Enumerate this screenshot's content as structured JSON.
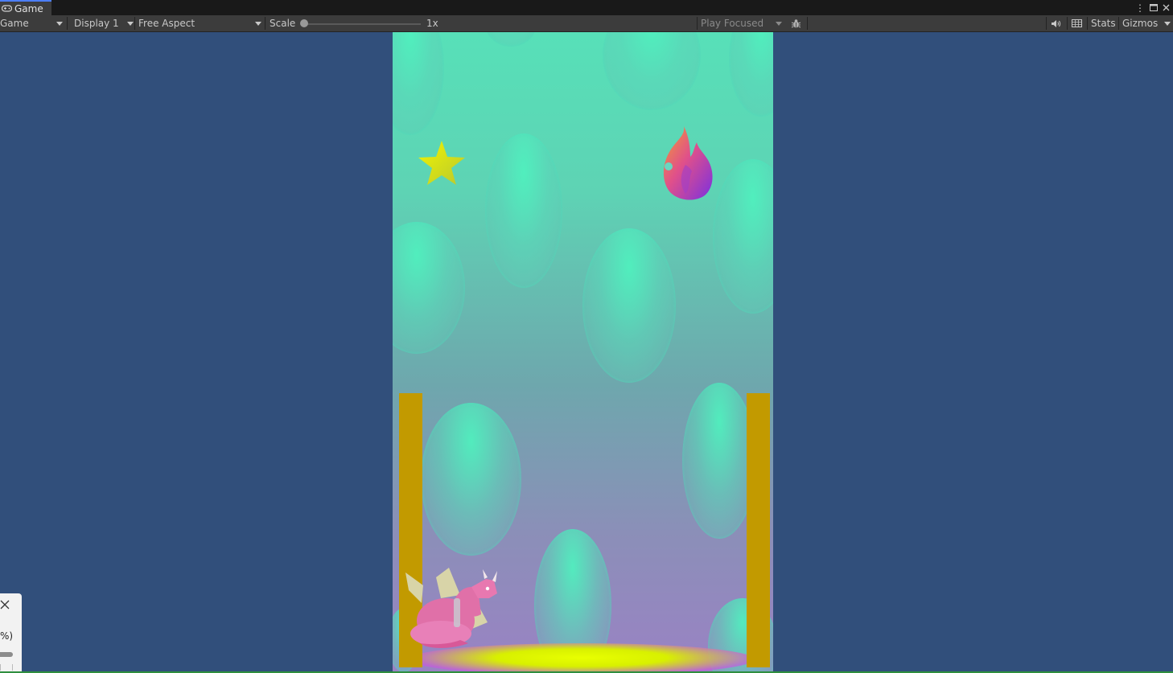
{
  "window": {
    "tab_label": "Game",
    "tab_icon": "gamepad-icon",
    "controls": [
      "kebab-menu-icon",
      "maximize-icon",
      "close-icon"
    ]
  },
  "toolbar": {
    "view_mode": "Game",
    "display": "Display 1",
    "aspect": "Free Aspect",
    "scale_label": "Scale",
    "scale_value": "1x",
    "scale_fraction": 0.0,
    "play_mode": "Play Focused",
    "bug_icon": "bug-icon",
    "audio_icon": "speaker-icon",
    "grid_icon": "grid-icon",
    "stats_label": "Stats",
    "gizmos_label": "Gizmos"
  },
  "game": {
    "sprites": [
      "star-pickup",
      "flame-pickup",
      "dragon-player"
    ],
    "colors": {
      "pillar": "#c29a00",
      "glow": "#e8ff00",
      "background_top": "#57e0b8",
      "background_bottom": "#9a82c4"
    }
  },
  "side_panel": {
    "close_icon": "close-icon",
    "percent_text": "%)"
  },
  "colors": {
    "editor_bg": "#314f7b",
    "toolbar_bg": "#3c3c3c",
    "titlebar_bg": "#191919",
    "tab_accent": "#4c7fff"
  }
}
